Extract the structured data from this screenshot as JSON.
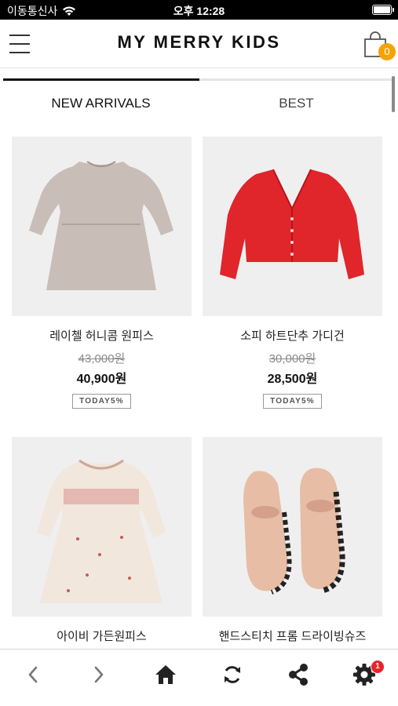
{
  "status_bar": {
    "carrier": "이동통신사",
    "time": "오후 12:28",
    "icons": [
      "wifi-icon",
      "battery-icon"
    ]
  },
  "header": {
    "logo": "MY MERRY KIDS",
    "cart_count": "0",
    "icons": [
      "menu-icon",
      "shopping-bag-icon"
    ],
    "badge_color": "#f4a300"
  },
  "tabs": [
    {
      "label": "NEW ARRIVALS",
      "active": true
    },
    {
      "label": "BEST",
      "active": false
    }
  ],
  "products": [
    {
      "name": "레이첼 허니콤 원피스",
      "original_price": "43,000원",
      "sale_price": "40,900원",
      "badge": "TODAY5%"
    },
    {
      "name": "소피 하트단추 가디건",
      "original_price": "30,000원",
      "sale_price": "28,500원",
      "badge": "TODAY5%"
    },
    {
      "name": "아이비 가든원피스",
      "original_price": "",
      "sale_price": "",
      "badge": ""
    },
    {
      "name": "핸드스티치 프롬 드라이빙슈즈",
      "original_price": "",
      "sale_price": "",
      "badge": ""
    }
  ],
  "bottom_nav": {
    "icons": [
      "back-arrow-icon",
      "forward-arrow-icon",
      "home-icon",
      "refresh-icon",
      "share-icon",
      "gear-icon"
    ],
    "settings_badge": "1",
    "badge_color": "#e8232a"
  }
}
